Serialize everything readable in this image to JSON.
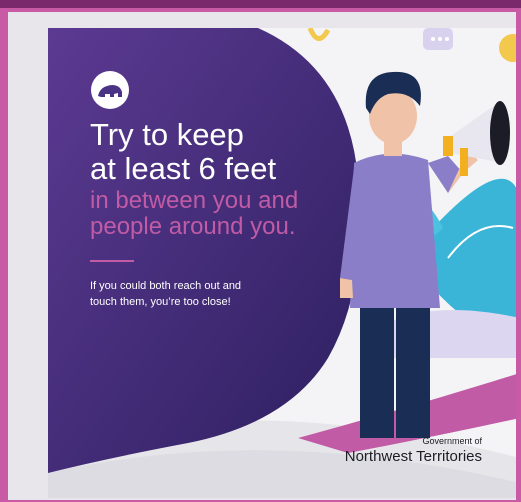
{
  "poster": {
    "headline": "Try to keep\nat least 6 feet",
    "subhead": "in between you and\npeople around you.",
    "body": "If you could both reach out and\ntouch them, you’re too close!",
    "gov_line1": "Government of",
    "gov_line2": "Northwest Territories",
    "logo_icon": "polar-bear-icon"
  },
  "colors": {
    "border": "#c85aa6",
    "purple_dark": "#2c1f5f",
    "purple_light": "#5c3a92",
    "accent_pink": "#c15ba5",
    "shirt": "#8a7ec8",
    "pants": "#1a2d55",
    "megaphone": "#f2b021",
    "leaves": "#3ab5d8"
  }
}
